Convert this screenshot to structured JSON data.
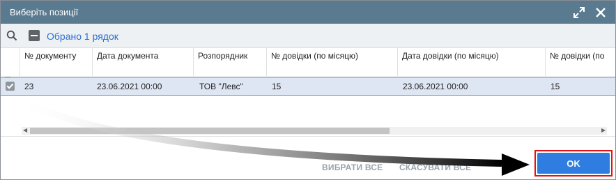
{
  "dialog": {
    "title": "Виберіть позиції"
  },
  "toolbar": {
    "selected_label": "Обрано 1 рядок"
  },
  "table": {
    "columns": [
      "№ документу",
      "Дата документа",
      "Розпорядник",
      "№ довідки (по місяцю)",
      "Дата довідки (по місяцю)",
      "№ довідки (по"
    ],
    "filter_placeholder": "...",
    "rows": [
      {
        "checked": true,
        "cells": [
          "23",
          "23.06.2021 00:00",
          "ТОВ \"Левс\"",
          "15",
          "23.06.2021 00:00",
          "15"
        ]
      }
    ]
  },
  "footer": {
    "select_all_label": "ВИБРАТИ ВСЕ",
    "cancel_label": "СКАСУВАТИ ВСЕ",
    "ok_label": "OK"
  },
  "colors": {
    "titlebar": "#5a7a90",
    "accent": "#2f7de0",
    "highlight": "#e01414"
  }
}
